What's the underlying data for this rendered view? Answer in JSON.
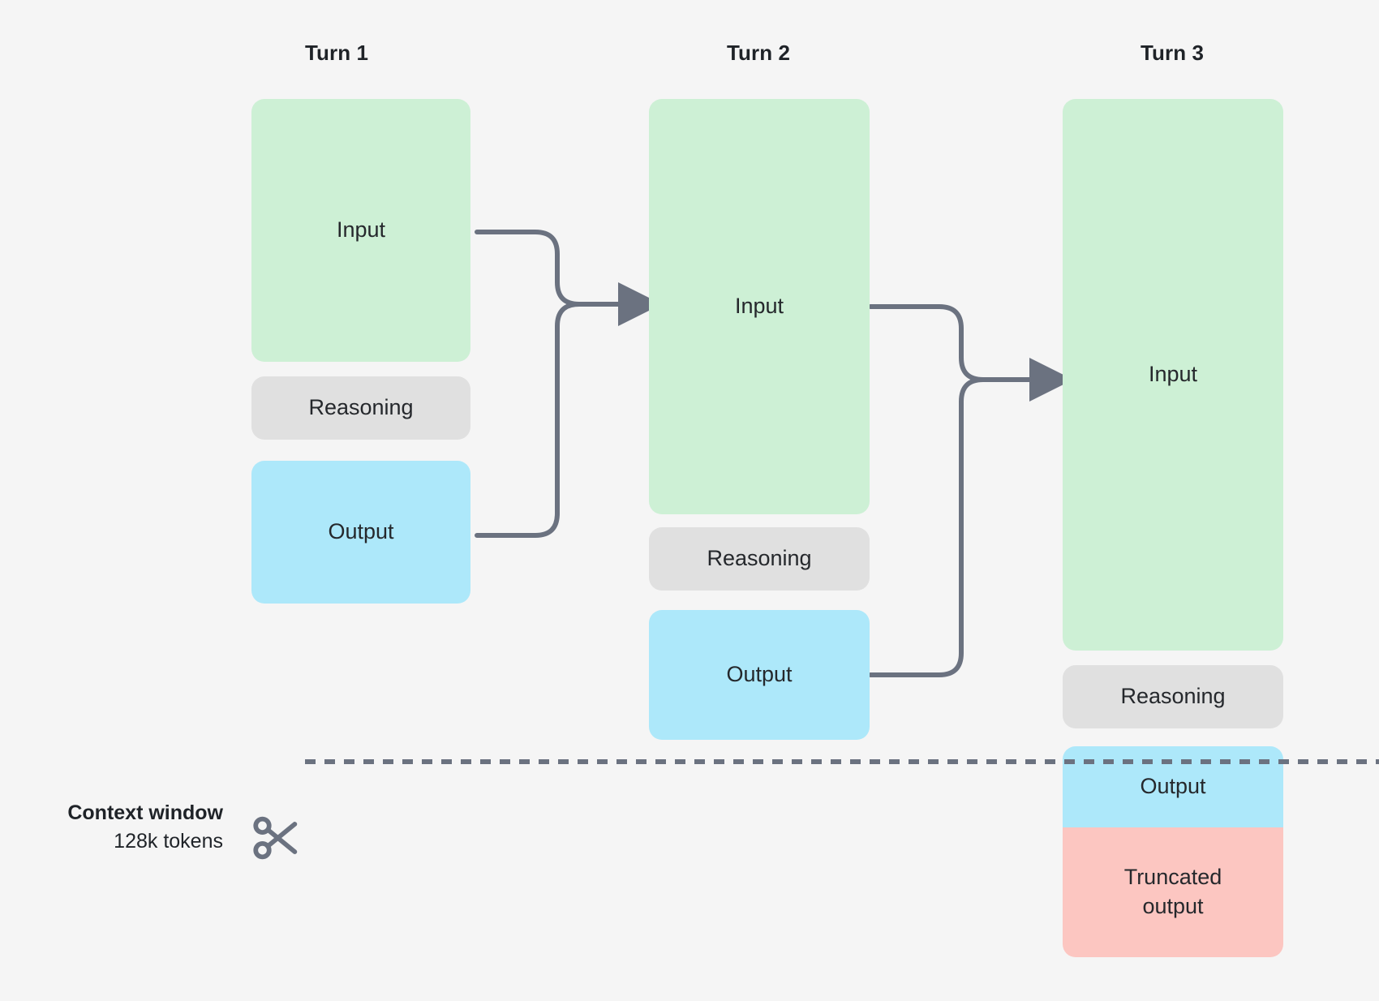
{
  "diagram": {
    "title_turn1": "Turn 1",
    "title_turn2": "Turn 2",
    "title_turn3": "Turn 3",
    "labels": {
      "input": "Input",
      "reasoning": "Reasoning",
      "output": "Output",
      "truncated_output": "Truncated output"
    },
    "context_window": {
      "title": "Context window",
      "subtitle": "128k tokens",
      "icon": "scissors-icon"
    },
    "colors": {
      "background": "#f5f5f5",
      "input_green": "#cdf0d5",
      "reasoning_gray": "#e0e0e0",
      "output_blue": "#ade8fa",
      "truncated_pink": "#fcc6c1",
      "connector": "#6b7280",
      "text": "#25282c",
      "title_text": "#1f2328"
    },
    "columns": [
      {
        "name": "turn-1",
        "title": "Turn 1",
        "blocks": [
          {
            "label": "Input",
            "color": "green"
          },
          {
            "label": "Reasoning",
            "color": "gray"
          },
          {
            "label": "Output",
            "color": "blue"
          }
        ]
      },
      {
        "name": "turn-2",
        "title": "Turn 2",
        "blocks": [
          {
            "label": "Input",
            "color": "green"
          },
          {
            "label": "Reasoning",
            "color": "gray"
          },
          {
            "label": "Output",
            "color": "blue"
          }
        ]
      },
      {
        "name": "turn-3",
        "title": "Turn 3",
        "blocks": [
          {
            "label": "Input",
            "color": "green"
          },
          {
            "label": "Reasoning",
            "color": "gray"
          },
          {
            "label": "Output",
            "color": "blue"
          },
          {
            "label": "Truncated output",
            "color": "pink"
          }
        ]
      }
    ]
  }
}
